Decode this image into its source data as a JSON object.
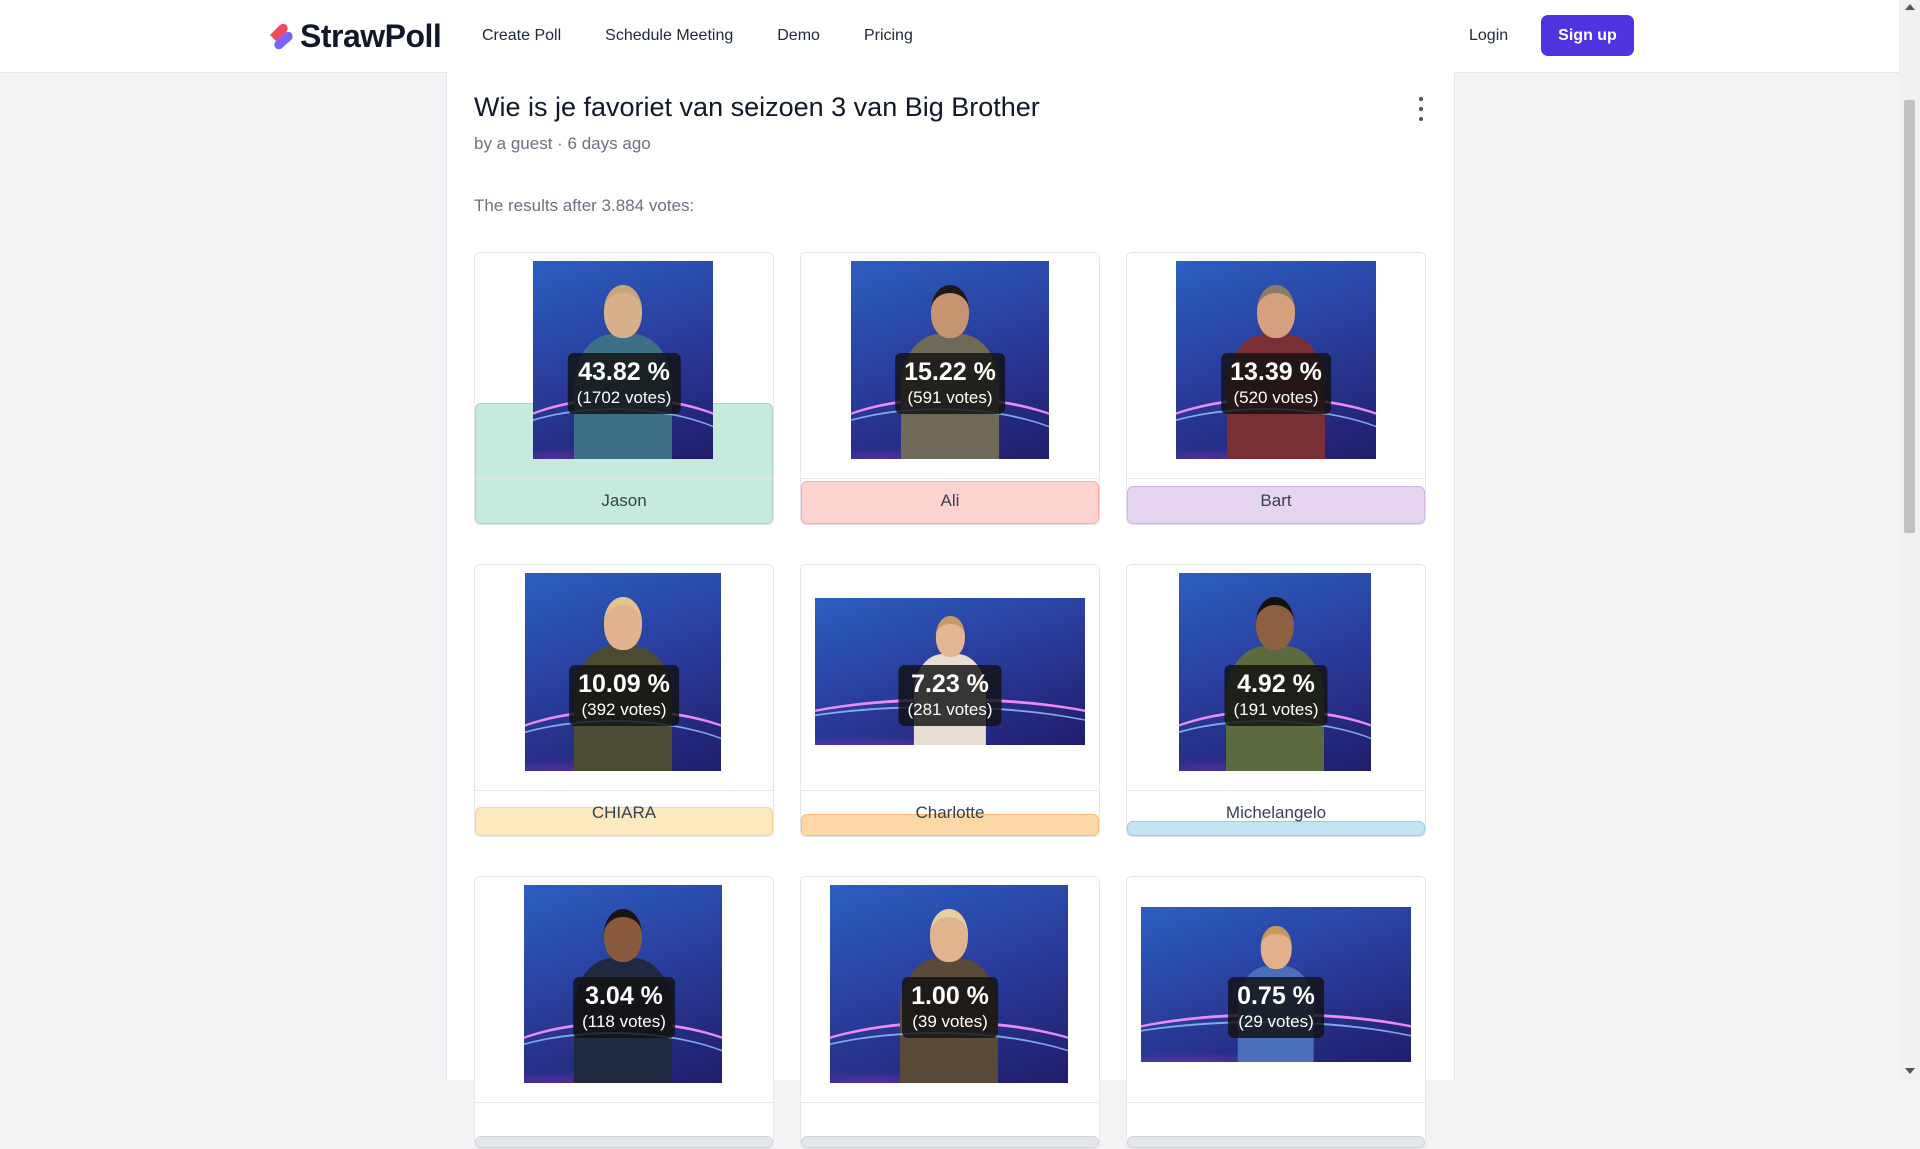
{
  "header": {
    "brand": "StrawPoll",
    "nav": [
      {
        "label": "Create Poll"
      },
      {
        "label": "Schedule Meeting"
      },
      {
        "label": "Demo"
      },
      {
        "label": "Pricing"
      }
    ],
    "login_label": "Login",
    "signup_label": "Sign up"
  },
  "poll": {
    "title": "Wie is je favoriet van seizoen 3 van Big Brother",
    "byline": "by a guest · 6 days ago",
    "results_summary": "The results after 3.884 votes:",
    "options": [
      {
        "name": "Jason",
        "percent_label": "43.82 %",
        "votes_label": "(1702 votes)",
        "share": 0.4382,
        "bar_color": "#c6ebdc",
        "bar_border": "#9fd9c2",
        "skin": "#d9b08c",
        "shirt": "#3d6f86",
        "hair": "#c9a678"
      },
      {
        "name": "Ali",
        "percent_label": "15.22 %",
        "votes_label": "(591 votes)",
        "share": 0.1522,
        "bar_color": "#fdd3d0",
        "bar_border": "#f6aaa4",
        "skin": "#c79472",
        "shirt": "#6f6a58",
        "hair": "#1c1a18"
      },
      {
        "name": "Bart",
        "percent_label": "13.39 %",
        "votes_label": "(520 votes)",
        "share": 0.1339,
        "bar_color": "#e6d5f1",
        "bar_border": "#cfb3e6",
        "skin": "#d6a07f",
        "shirt": "#7a2f35",
        "hair": "#8a7a66"
      },
      {
        "name": "CHIARA",
        "percent_label": "10.09 %",
        "votes_label": "(392 votes)",
        "share": 0.1009,
        "bar_color": "#fde9c0",
        "bar_border": "#f8d48d",
        "skin": "#e2b28f",
        "shirt": "#4b4a33",
        "hair": "#e0c58f"
      },
      {
        "name": "Charlotte",
        "percent_label": "7.23 %",
        "votes_label": "(281 votes)",
        "share": 0.0723,
        "bar_color": "#fcd8a8",
        "bar_border": "#f6bd72",
        "skin": "#e4b794",
        "shirt": "#e8ddd1",
        "hair": "#c49a68"
      },
      {
        "name": "Michelangelo",
        "percent_label": "4.92 %",
        "votes_label": "(191 votes)",
        "share": 0.0492,
        "bar_color": "#c5e4f3",
        "bar_border": "#93cbe6",
        "skin": "#8d5f43",
        "shirt": "#5b6b3f",
        "hair": "#111111"
      },
      {
        "name": "",
        "percent_label": "3.04 %",
        "votes_label": "(118 votes)",
        "share": 0.0304,
        "bar_color": "#e5e7eb",
        "bar_border": "#d1d5db",
        "skin": "#8a5a3e",
        "shirt": "#1f2a40",
        "hair": "#1a1410"
      },
      {
        "name": "",
        "percent_label": "1.00 %",
        "votes_label": "(39 votes)",
        "share": 0.01,
        "bar_color": "#e5e7eb",
        "bar_border": "#d1d5db",
        "skin": "#e0b48e",
        "shirt": "#5b4a3a",
        "hair": "#e6cf9a"
      },
      {
        "name": "",
        "percent_label": "0.75 %",
        "votes_label": "(29 votes)",
        "share": 0.0075,
        "bar_color": "#e5e7eb",
        "bar_border": "#d1d5db",
        "skin": "#e2b08a",
        "shirt": "#4a6fb8",
        "hair": "#c79a5c"
      }
    ]
  },
  "icons": {
    "logo": "strawpoll-logo-icon",
    "menu": "kebab-menu-icon"
  }
}
